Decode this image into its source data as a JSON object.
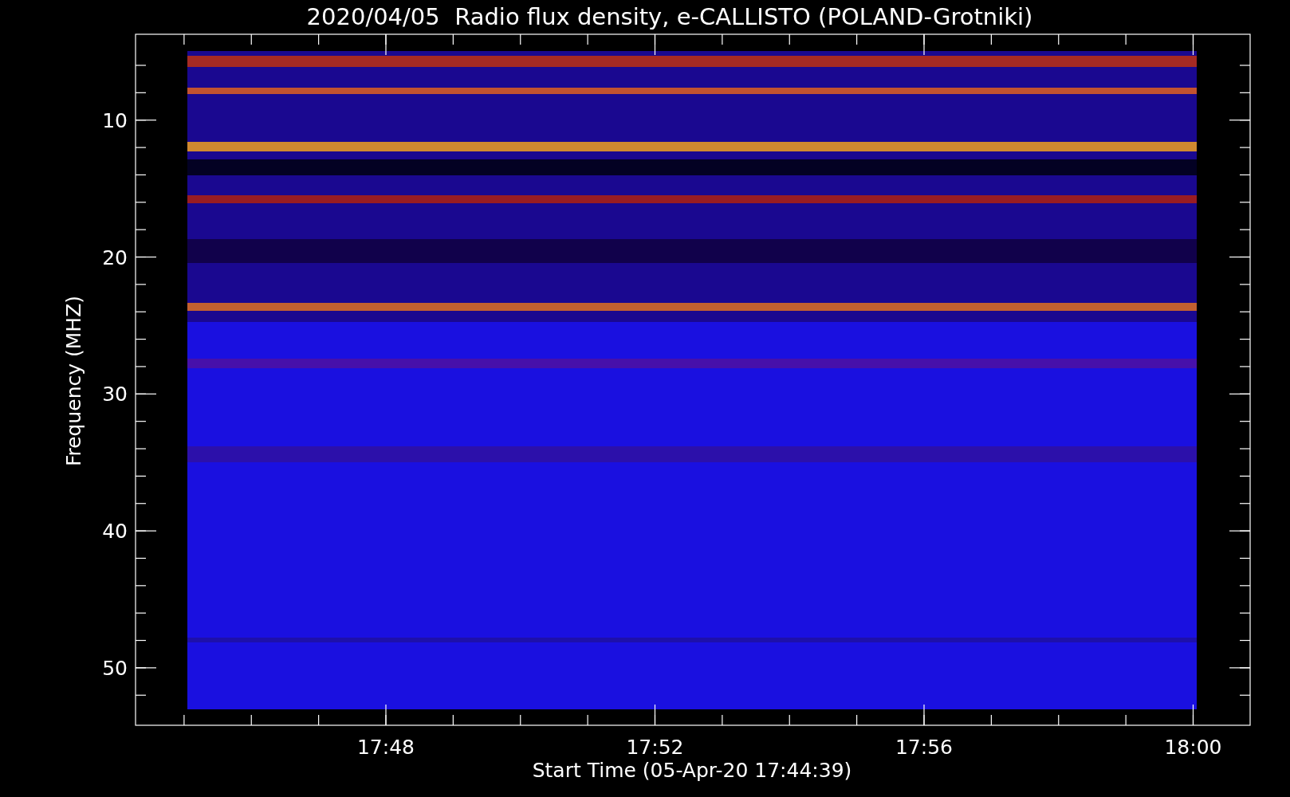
{
  "title": "2020/04/05  Radio flux density, e-CALLISTO (POLAND-Grotniki)",
  "y_axis": {
    "label": "Frequency (MHZ)",
    "ticks": [
      "10",
      "20",
      "30",
      "40",
      "50"
    ]
  },
  "x_axis": {
    "label": "Start Time (05-Apr-20 17:44:39)",
    "ticks": [
      "17:48",
      "17:52",
      "17:56",
      "18:00"
    ]
  }
}
